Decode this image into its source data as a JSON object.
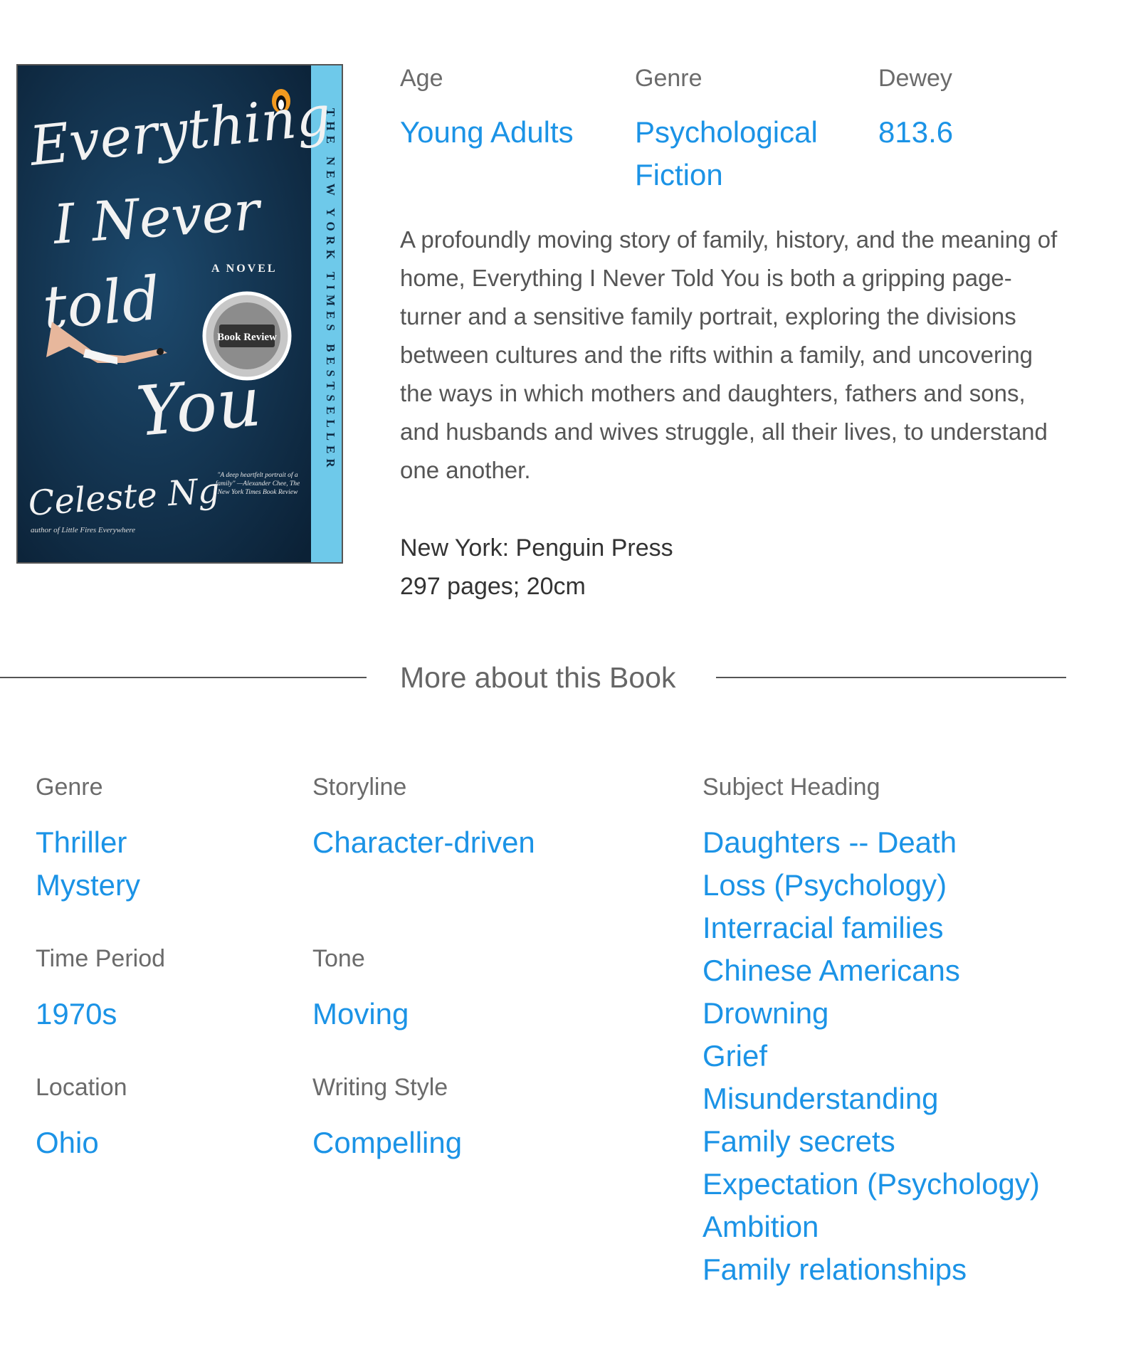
{
  "cover": {
    "title_lines": [
      "Everything",
      "I Never",
      "told",
      "You"
    ],
    "author": "Celeste Ng",
    "spine_text": "THE NEW YORK TIMES BESTSELLER",
    "novel_label": "A NOVEL",
    "badge_text": "Book Review",
    "quote": "\"A deep heartfelt portrait of a family\" —Alexander Chee, The New York Times Book Review",
    "author_note": "author of Little Fires Everywhere",
    "colors": {
      "background": "#0f2b44",
      "spine": "#6ec9ea",
      "lettering": "#f2f2f2"
    }
  },
  "meta": {
    "age": {
      "label": "Age",
      "value": "Young Adults"
    },
    "genre": {
      "label": "Genre",
      "value_line1": "Psychological",
      "value_line2": "Fiction"
    },
    "dewey": {
      "label": "Dewey",
      "value": "813.6"
    }
  },
  "description": "A profoundly moving story of family, history, and the meaning of home, Everything I Never Told You is both a gripping page-turner and a sensitive family portrait, exploring the divisions between cultures and the rifts within a family, and uncovering the ways in which mothers and daughters, fathers and sons, and husbands and wives struggle, all their lives, to understand one another.",
  "publication": {
    "publisher": "New York: Penguin Press",
    "physical": "297 pages; 20cm"
  },
  "more_section": {
    "title": "More about this Book"
  },
  "facets": {
    "genre": {
      "label": "Genre",
      "items": [
        "Thriller",
        "Mystery"
      ]
    },
    "storyline": {
      "label": "Storyline",
      "items": [
        "Character-driven"
      ]
    },
    "time_period": {
      "label": "Time Period",
      "items": [
        "1970s"
      ]
    },
    "tone": {
      "label": "Tone",
      "items": [
        "Moving"
      ]
    },
    "location": {
      "label": "Location",
      "items": [
        "Ohio"
      ]
    },
    "writing_style": {
      "label": "Writing Style",
      "items": [
        "Compelling"
      ]
    },
    "subject_heading": {
      "label": "Subject Heading",
      "items": [
        "Daughters -- Death",
        "Loss (Psychology)",
        "Interracial families",
        "Chinese Americans",
        "Drowning",
        "Grief",
        "Misunderstanding",
        "Family secrets",
        "Expectation (Psychology)",
        "Ambition",
        "Family relationships"
      ]
    }
  },
  "colors": {
    "link": "#1b93e6",
    "label": "#6b6b6b",
    "body_text": "#555555"
  }
}
